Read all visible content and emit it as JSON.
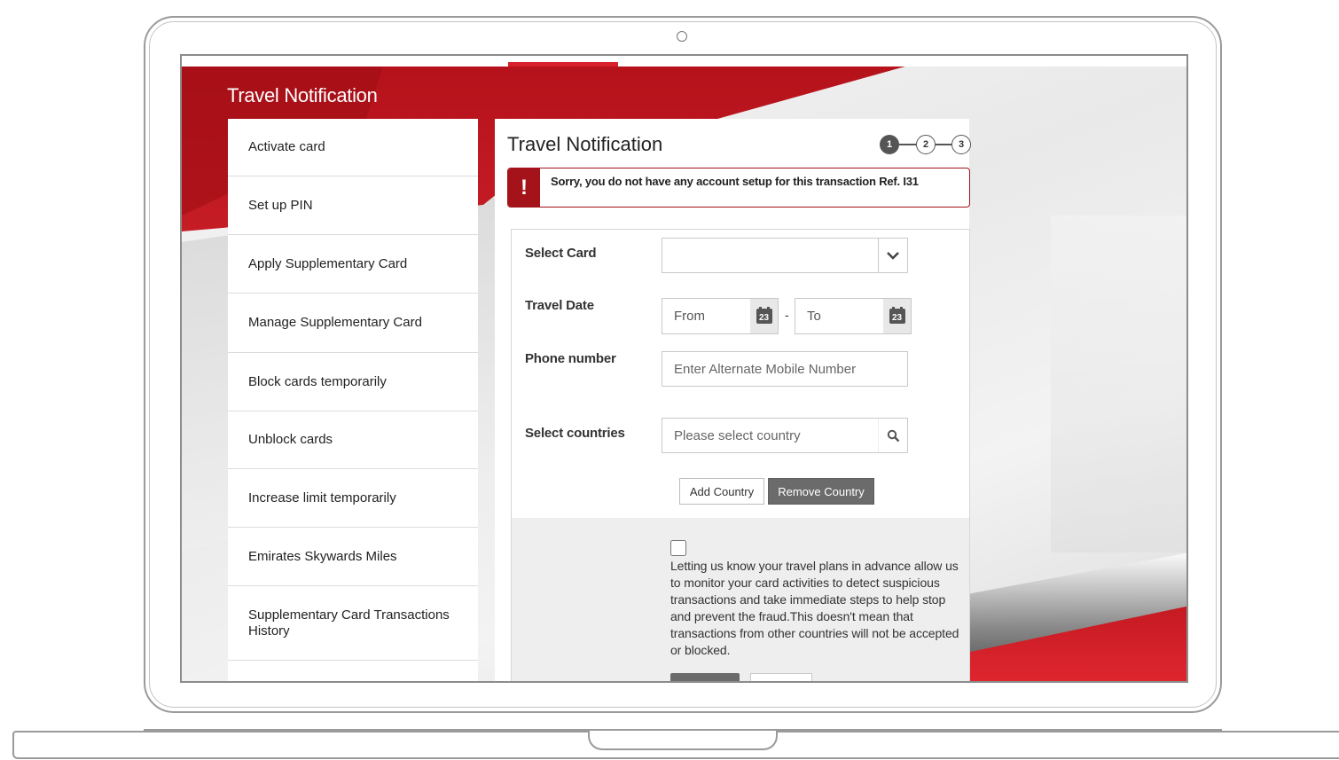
{
  "page": {
    "title": "Travel Notification"
  },
  "sidebar": {
    "items": [
      {
        "label": "Activate card"
      },
      {
        "label": "Set up PIN"
      },
      {
        "label": "Apply Supplementary Card"
      },
      {
        "label": "Manage Supplementary Card"
      },
      {
        "label": "Block cards temporarily"
      },
      {
        "label": "Unblock cards"
      },
      {
        "label": "Increase limit temporarily"
      },
      {
        "label": "Emirates Skywards Miles"
      },
      {
        "label": "Supplementary Card Transactions History"
      }
    ]
  },
  "panel": {
    "title": "Travel Notification",
    "steps": [
      "1",
      "2",
      "3"
    ],
    "active_step": 1,
    "alert": {
      "icon": "!",
      "message": "Sorry, you do not have any account setup for this transaction Ref. I31"
    },
    "form": {
      "select_card_label": "Select Card",
      "select_card_value": "",
      "travel_date_label": "Travel Date",
      "from_placeholder": "From",
      "to_placeholder": "To",
      "calendar_day": "23",
      "date_separator": "-",
      "phone_label": "Phone number",
      "phone_placeholder": "Enter Alternate Mobile Number",
      "countries_label": "Select countries",
      "countries_placeholder": "Please select country",
      "add_country_label": "Add Country",
      "remove_country_label": "Remove Country"
    },
    "consent": {
      "checked": false,
      "text": "Letting us know your travel plans in advance allow us to monitor your card activities to detect suspicious transactions and take immediate steps to help stop and prevent the fraud.This doesn't mean that transactions from other countries will not be accepted or blocked."
    }
  },
  "icons": {
    "dropdown": "chevron-down-icon",
    "calendar": "calendar-icon",
    "search": "search-icon",
    "alert": "alert-icon"
  },
  "colors": {
    "brand_red": "#d8202a",
    "alert_red": "#a31319",
    "button_gray": "#6b6b6b",
    "step_active": "#555555"
  }
}
